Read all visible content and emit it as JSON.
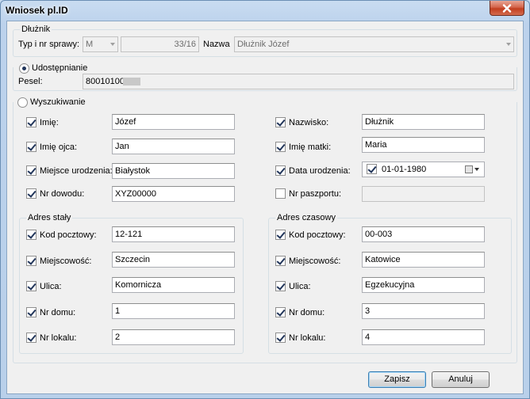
{
  "window": {
    "title": "Wniosek pl.ID"
  },
  "dluznik": {
    "title": "Dłużnik",
    "typ_label": "Typ i nr sprawy:",
    "typ_value": "M",
    "nr_value": "33/16",
    "nazwa_label": "Nazwa",
    "nazwa_value": "Dłużnik Józef"
  },
  "udostepnianie": {
    "label": "Udostępnianie",
    "pesel_label": "Pesel:",
    "pesel_value": "80010100"
  },
  "wyszukiwanie": {
    "label": "Wyszukiwanie"
  },
  "person": {
    "imie": {
      "label": "Imię:",
      "value": "Józef",
      "checked": true
    },
    "nazwisko": {
      "label": "Nazwisko:",
      "value": "Dłużnik",
      "checked": true
    },
    "imie_ojca": {
      "label": "Imię ojca:",
      "value": "Jan",
      "checked": true
    },
    "imie_matki": {
      "label": "Imię matki:",
      "value": "Maria",
      "checked": true
    },
    "miejsce_urodzenia": {
      "label": "Miejsce urodzenia:",
      "value": "Białystok",
      "checked": true
    },
    "data_urodzenia": {
      "label": "Data urodzenia:",
      "value": "01-01-1980",
      "checked": true
    },
    "nr_dowodu": {
      "label": "Nr dowodu:",
      "value": "XYZ00000",
      "checked": true
    },
    "nr_paszportu": {
      "label": "Nr paszportu:",
      "value": "",
      "checked": false
    }
  },
  "adres_staly": {
    "title": "Adres stały",
    "kod": {
      "label": "Kod pocztowy:",
      "value": "12-121"
    },
    "miejscowosc": {
      "label": "Miejscowość:",
      "value": "Szczecin"
    },
    "ulica": {
      "label": "Ulica:",
      "value": "Komornicza"
    },
    "nr_domu": {
      "label": "Nr domu:",
      "value": "1"
    },
    "nr_lokalu": {
      "label": "Nr lokalu:",
      "value": "2"
    }
  },
  "adres_czasowy": {
    "title": "Adres czasowy",
    "kod": {
      "label": "Kod pocztowy:",
      "value": "00-003"
    },
    "miejscowosc": {
      "label": "Miejscowość:",
      "value": "Katowice"
    },
    "ulica": {
      "label": "Ulica:",
      "value": "Egzekucyjna"
    },
    "nr_domu": {
      "label": "Nr domu:",
      "value": "3"
    },
    "nr_lokalu": {
      "label": "Nr lokalu:",
      "value": "4"
    }
  },
  "buttons": {
    "zapisz": "Zapisz",
    "anuluj": "Anuluj"
  },
  "icons": {
    "close": "close-icon",
    "calendar": "calendar-icon",
    "dropdown": "chevron-down-icon"
  },
  "colors": {
    "accent": "#21355a",
    "close": "#c23e1f",
    "frame": "#b9d0ea"
  }
}
